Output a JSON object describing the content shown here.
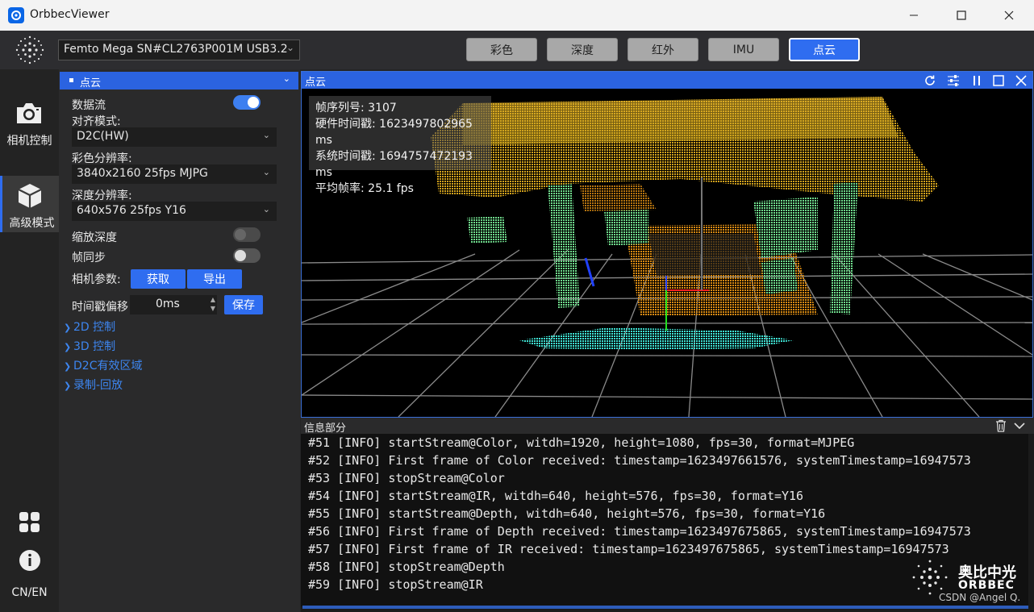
{
  "window": {
    "title": "OrbbecViewer"
  },
  "toolbar": {
    "device": "Femto Mega SN#CL2763P001M USB3.2",
    "tabs": [
      {
        "label": "彩色",
        "active": false
      },
      {
        "label": "深度",
        "active": false
      },
      {
        "label": "红外",
        "active": false
      },
      {
        "label": "IMU",
        "active": false
      },
      {
        "label": "点云",
        "active": true
      }
    ]
  },
  "rail": {
    "camera_control": "相机控制",
    "advanced_mode": "高级模式",
    "lang": "CN/EN"
  },
  "panel": {
    "title": "点云",
    "data_stream": {
      "label": "数据流",
      "on": true
    },
    "align_mode": {
      "label": "对齐模式:",
      "value": "D2C(HW)"
    },
    "color_res": {
      "label": "彩色分辨率:",
      "value": "3840x2160 25fps MJPG"
    },
    "depth_res": {
      "label": "深度分辨率:",
      "value": "640x576 25fps Y16"
    },
    "scale_depth": {
      "label": "缩放深度",
      "on": false
    },
    "frame_sync": {
      "label": "帧同步",
      "on": false
    },
    "camera_params": {
      "label": "相机参数:",
      "get": "获取",
      "export": "导出"
    },
    "timestamp_offset": {
      "label": "时间戳偏移",
      "value": "0ms",
      "save": "保存"
    },
    "sections": [
      "2D 控制",
      "3D 控制",
      "D2C有效区域",
      "录制-回放"
    ]
  },
  "viewer": {
    "title": "点云",
    "overlay": [
      "帧序列号: 3107",
      "硬件时间戳: 1623497802965 ms",
      "系统时间戳: 1694757472193 ms",
      "平均帧率: 25.1 fps"
    ]
  },
  "log": {
    "title": "信息部分",
    "lines": [
      "#51 [INFO] startStream@Color, witdh=1920, height=1080, fps=30, format=MJPEG",
      "#52 [INFO] First frame of Color received: timestamp=1623497661576, systemTimestamp=16947573",
      "#53 [INFO] stopStream@Color",
      "#54 [INFO] startStream@IR, witdh=640, height=576, fps=30, format=Y16",
      "#55 [INFO] startStream@Depth, witdh=640, height=576, fps=30, format=Y16",
      "#56 [INFO] First frame of Depth received: timestamp=1623497675865, systemTimestamp=16947573",
      "#57 [INFO] First frame of IR received: timestamp=1623497675865, systemTimestamp=16947573",
      "#58 [INFO] stopStream@Depth",
      "#59 [INFO] stopStream@IR"
    ]
  },
  "watermark": {
    "brand_cn": "奥比中光",
    "brand_en": "ORBBEC",
    "credit": "CSDN @Angel Q."
  },
  "colors": {
    "accent": "#2f6df0",
    "panel_header": "#2b63e0"
  }
}
